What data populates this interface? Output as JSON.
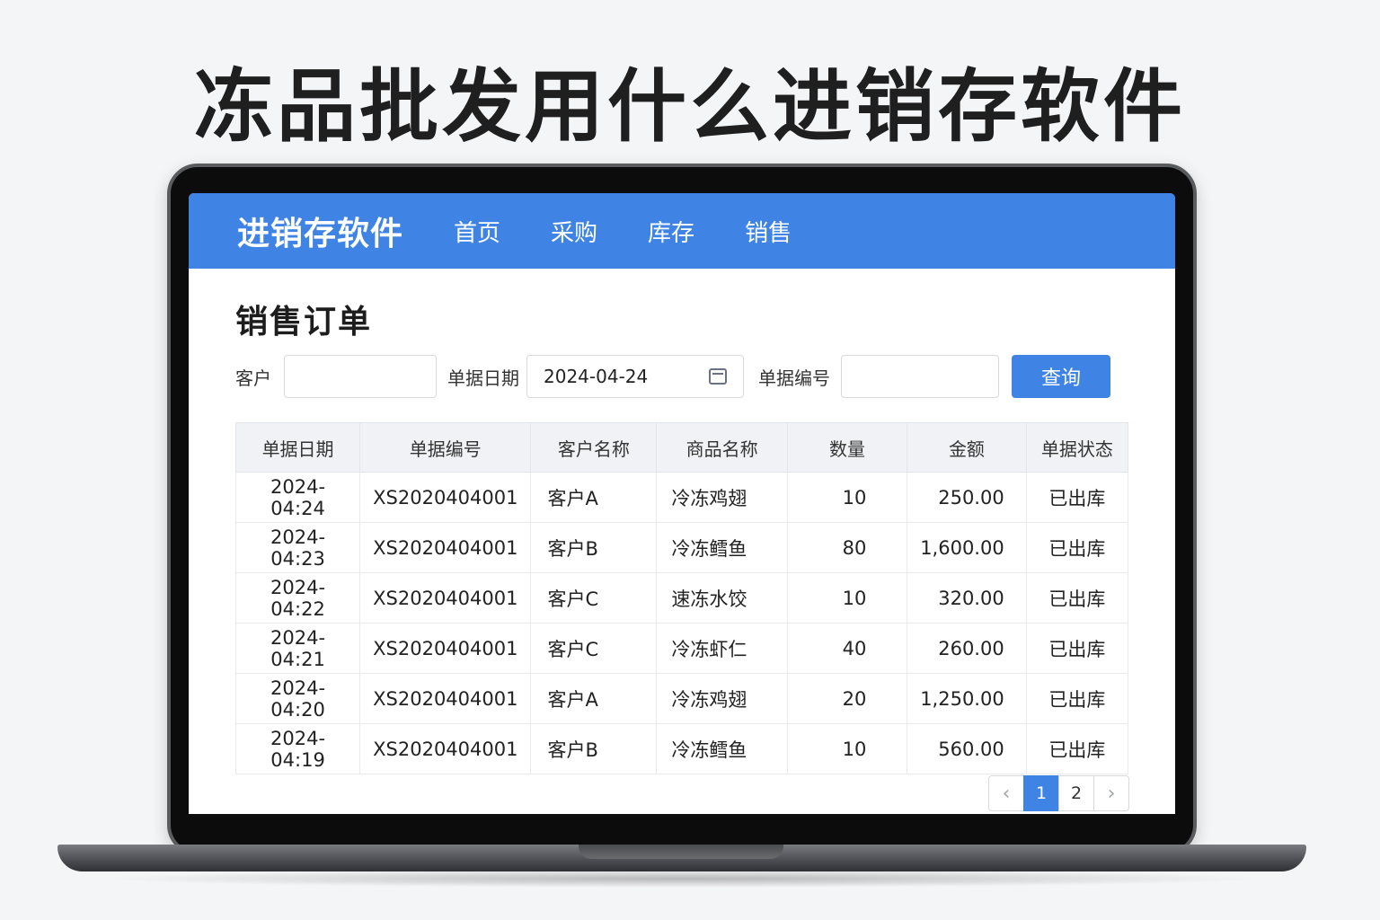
{
  "headline": "冻品批发用什么进销存软件",
  "nav": {
    "brand": "进销存软件",
    "items": [
      "首页",
      "采购",
      "库存",
      "销售"
    ]
  },
  "page_title": "销售订单",
  "filters": {
    "customer_label": "客户",
    "customer_value": "",
    "date_label": "单据日期",
    "date_value": "2024-04-24",
    "order_no_label": "单据编号",
    "order_no_value": "",
    "query_button": "查询"
  },
  "table": {
    "headers": [
      "单据日期",
      "单据编号",
      "客户名称",
      "商品名称",
      "数量",
      "金额",
      "单据状态"
    ],
    "rows": [
      {
        "date": "2024-04:24",
        "no": "XS2020404001",
        "customer": "客户A",
        "product": "冷冻鸡翅",
        "qty": "10",
        "amount": "250.00",
        "status": "已出库"
      },
      {
        "date": "2024-04:23",
        "no": "XS2020404001",
        "customer": "客户B",
        "product": "冷冻鳕鱼",
        "qty": "80",
        "amount": "1,600.00",
        "status": "已出库"
      },
      {
        "date": "2024-04:22",
        "no": "XS2020404001",
        "customer": "客户C",
        "product": "速冻水饺",
        "qty": "10",
        "amount": "320.00",
        "status": "已出库"
      },
      {
        "date": "2024-04:21",
        "no": "XS2020404001",
        "customer": "客户C",
        "product": "冷冻虾仁",
        "qty": "40",
        "amount": "260.00",
        "status": "已出库"
      },
      {
        "date": "2024-04:20",
        "no": "XS2020404001",
        "customer": "客户A",
        "product": "冷冻鸡翅",
        "qty": "20",
        "amount": "1,250.00",
        "status": "已出库"
      },
      {
        "date": "2024-04:19",
        "no": "XS2020404001",
        "customer": "客户B",
        "product": "冷冻鳕鱼",
        "qty": "10",
        "amount": "560.00",
        "status": "已出库"
      }
    ]
  },
  "pagination": {
    "prev": "‹",
    "pages": [
      "1",
      "2"
    ],
    "current": "1",
    "next": "›"
  },
  "colors": {
    "accent": "#3f84e5",
    "page_bg": "#f4f5f7"
  }
}
